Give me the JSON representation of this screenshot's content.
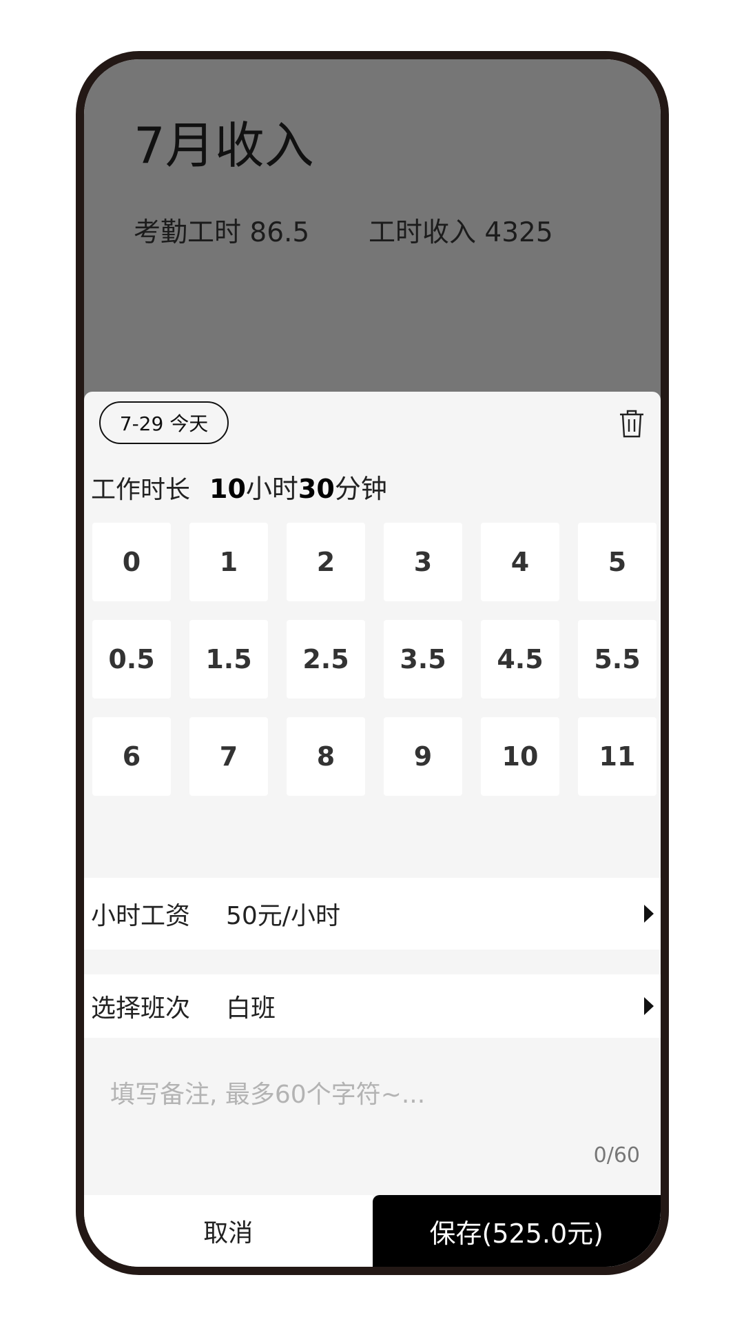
{
  "header": {
    "title": "7月收入",
    "attendance_hours": "考勤工时 86.5",
    "hour_income": "工时收入 4325"
  },
  "sheet": {
    "date_chip": "7-29 今天",
    "duration": {
      "label": "工作时长",
      "hours": "10",
      "hours_unit": "小时",
      "minutes": "30",
      "minutes_unit": "分钟"
    },
    "keys": [
      "0",
      "1",
      "2",
      "3",
      "4",
      "5",
      "0.5",
      "1.5",
      "2.5",
      "3.5",
      "4.5",
      "5.5",
      "6",
      "7",
      "8",
      "9",
      "10",
      "11"
    ],
    "wage": {
      "label": "小时工资",
      "value": "50元/小时"
    },
    "shift": {
      "label": "选择班次",
      "value": "白班"
    },
    "notes": {
      "placeholder": "填写备注, 最多60个字符~...",
      "count": "0/60"
    }
  },
  "footer": {
    "cancel_label": "取消",
    "save_label": "保存(525.0元)"
  },
  "icons": {
    "trash": "trash-icon",
    "arrow": "caret-right-icon"
  },
  "colors": {
    "header_bg": "#767676",
    "sheet_bg": "#f5f5f5",
    "save_bg": "#000000",
    "phone_frame": "#231815"
  }
}
